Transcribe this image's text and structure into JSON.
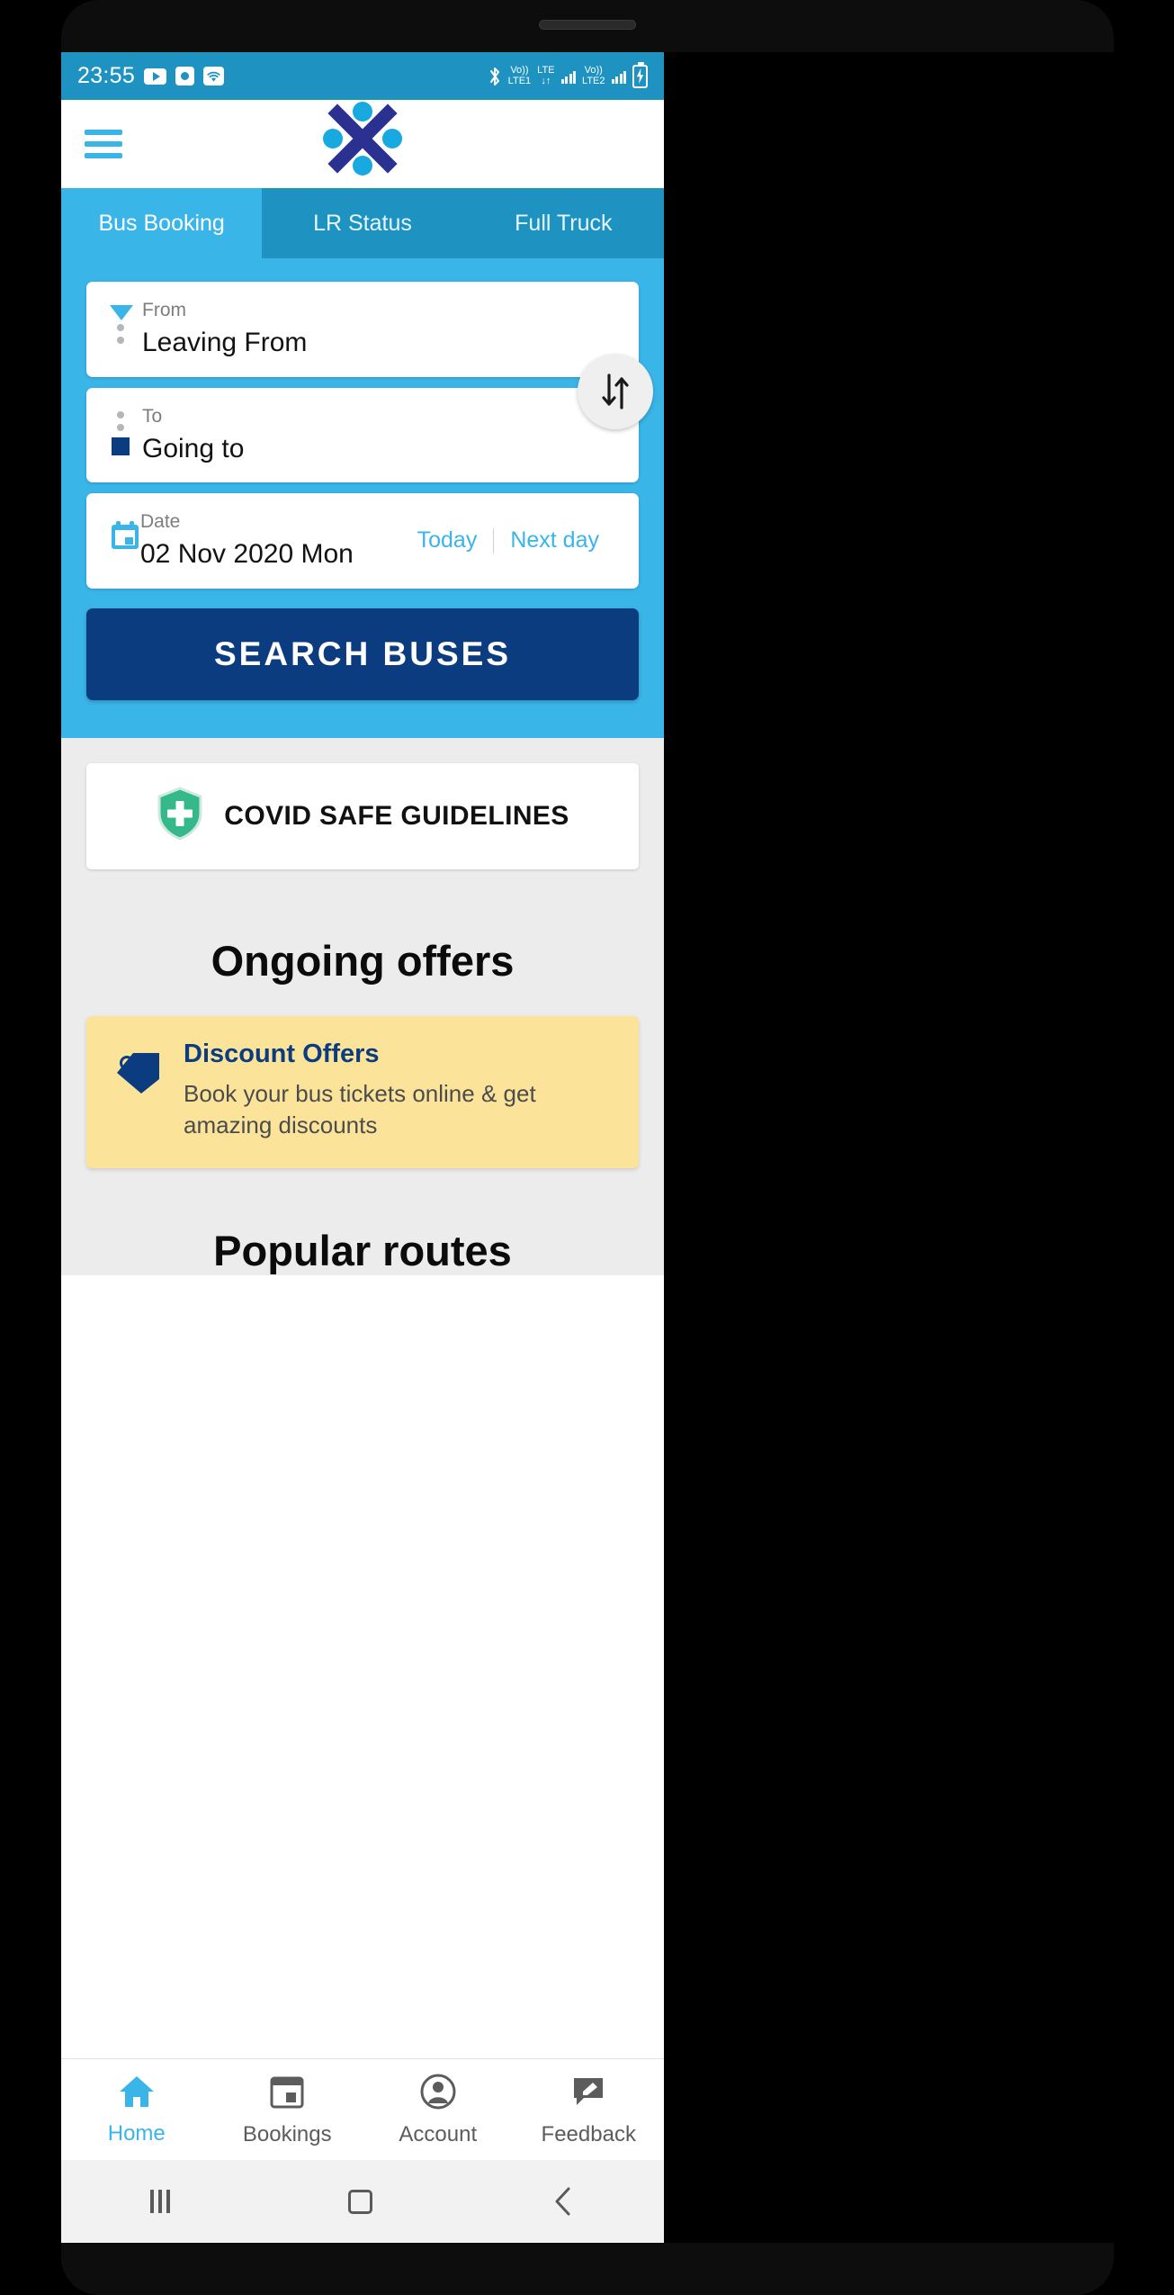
{
  "status_bar": {
    "time": "23:55",
    "icons_left": [
      "youtube-icon",
      "screen-record-icon",
      "wifi-icon"
    ],
    "bluetooth": "bluetooth-icon",
    "sim1_label_top": "Vo))",
    "sim1_label_bottom": "LTE1",
    "lte_top": "LTE",
    "lte_bottom": "",
    "sim2_label_top": "Vo))",
    "sim2_label_bottom": "LTE2",
    "battery": "battery-charging-icon",
    "background_color": "#1e93c2"
  },
  "header": {
    "menu_icon": "hamburger-menu-icon",
    "logo": "app-logo",
    "logo_colors": {
      "navy": "#2b3191",
      "blue": "#18a9e0"
    }
  },
  "tabs": {
    "items": [
      {
        "label": "Bus Booking",
        "active": true
      },
      {
        "label": "LR Status",
        "active": false
      },
      {
        "label": "Full Truck",
        "active": false
      }
    ],
    "active_bg": "#3ab5e8",
    "inactive_bg": "#1e93c2"
  },
  "search_form": {
    "from": {
      "label": "From",
      "value": "Leaving From",
      "icon": "triangle-down-marker"
    },
    "to": {
      "label": "To",
      "value": "Going to",
      "icon": "square-marker"
    },
    "swap_icon": "swap-vertical-arrows-icon",
    "date": {
      "label": "Date",
      "value": "02 Nov 2020 Mon",
      "icon": "calendar-icon",
      "today_label": "Today",
      "next_day_label": "Next day"
    },
    "search_button_label": "SEARCH BUSES",
    "search_button_color": "#0c3c80",
    "panel_color": "#3ab5e8"
  },
  "covid_card": {
    "text": "COVID SAFE GUIDELINES",
    "icon": "shield-plus-icon",
    "icon_color": "#35b88a"
  },
  "offers": {
    "section_title": "Ongoing offers",
    "cards": [
      {
        "title": "Discount Offers",
        "description": "Book your bus tickets online & get amazing discounts",
        "icon": "tag-icon",
        "background": "#fbe49a"
      }
    ]
  },
  "popular": {
    "section_title": "Popular routes"
  },
  "bottom_nav": {
    "items": [
      {
        "label": "Home",
        "icon": "home-icon",
        "active": true
      },
      {
        "label": "Bookings",
        "icon": "bookings-icon",
        "active": false
      },
      {
        "label": "Account",
        "icon": "account-icon",
        "active": false
      },
      {
        "label": "Feedback",
        "icon": "feedback-icon",
        "active": false
      }
    ],
    "active_color": "#3ab5e8",
    "inactive_color": "#5c5c5c"
  },
  "system_nav": {
    "recents": "recents-icon",
    "home": "home-square-icon",
    "back": "back-chevron-icon"
  }
}
